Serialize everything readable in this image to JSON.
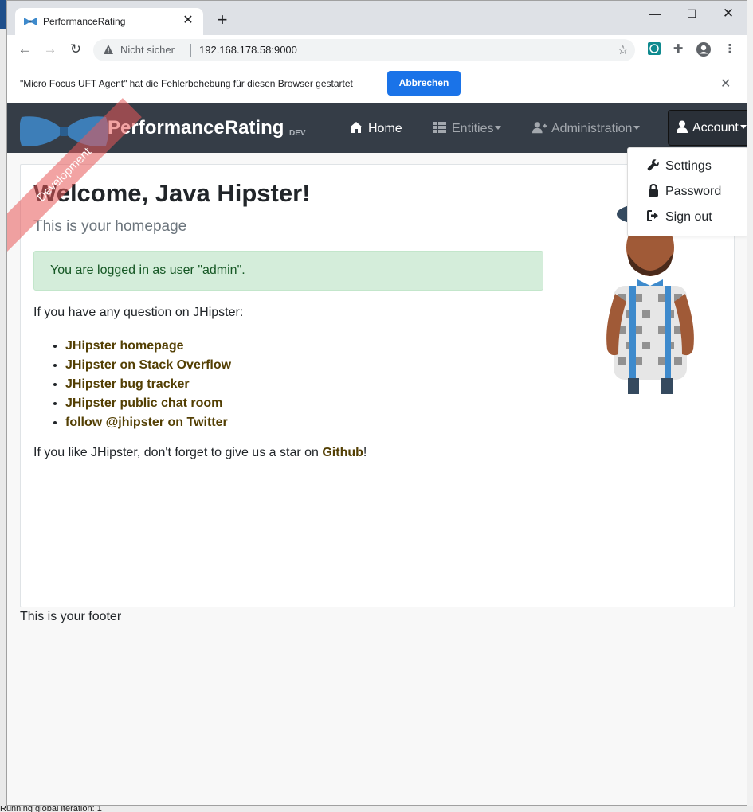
{
  "browser": {
    "tab_title": "PerformanceRating",
    "address_security": "Nicht sicher",
    "url": "192.168.178.58:9000"
  },
  "infobar": {
    "message": "\"Micro Focus UFT Agent\" hat die Fehlerbehebung für diesen Browser gestartet",
    "cancel_label": "Abbrechen"
  },
  "navbar": {
    "brand": "PerformanceRating",
    "env_badge": "DEV",
    "ribbon": "Development",
    "home": "Home",
    "entities": "Entities",
    "administration": "Administration",
    "account": "Account"
  },
  "account_menu": {
    "settings": "Settings",
    "password": "Password",
    "sign_out": "Sign out"
  },
  "main": {
    "title": "Welcome, Java Hipster!",
    "subtitle": "This is your homepage",
    "alert": "You are logged in as user \"admin\".",
    "question": "If you have any question on JHipster:",
    "links": [
      "JHipster homepage",
      "JHipster on Stack Overflow",
      "JHipster bug tracker",
      "JHipster public chat room",
      "follow @jhipster on Twitter"
    ],
    "star_prefix": "If you like JHipster, don't forget to give us a star on ",
    "star_link": "Github",
    "star_suffix": "!"
  },
  "footer": {
    "text": "This is your footer"
  },
  "desktop": {
    "status_text": "Running global iteration: 1"
  },
  "colors": {
    "navbar_bg": "#353d47",
    "link": "#533f03",
    "alert_bg": "#d4edda",
    "button_blue": "#1a73e8",
    "ribbon": "#e85858"
  },
  "icons": [
    "bowtie-favicon",
    "warning-icon",
    "star-icon",
    "home-icon",
    "table-icon",
    "user-plus-icon",
    "user-icon",
    "wrench-icon",
    "lock-icon",
    "sign-out-icon"
  ]
}
